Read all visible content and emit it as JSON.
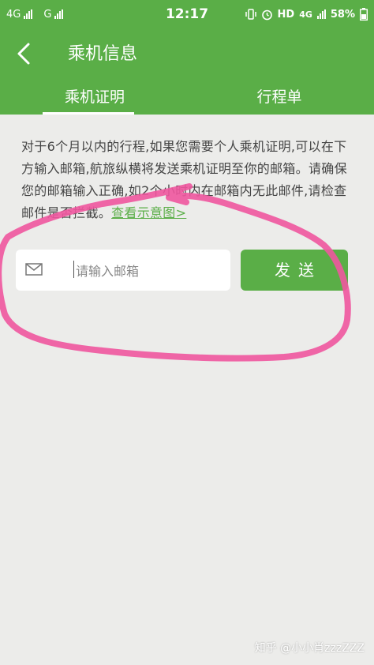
{
  "status": {
    "left_network_1": "4G",
    "left_network_2": "G",
    "time": "12:17",
    "right_network": "HD",
    "right_4g": "4G",
    "battery": "58%"
  },
  "header": {
    "title": "乘机信息"
  },
  "tabs": [
    {
      "label": "乘机证明",
      "active": true
    },
    {
      "label": "行程单",
      "active": false
    }
  ],
  "notice": {
    "text": "对于6个月以内的行程,如果您需要个人乘机证明,可以在下方输入邮箱,航旅纵横将发送乘机证明至你的邮箱。请确保您的邮箱输入正确,如2个小时内在邮箱内无此邮件,请检查邮件是否拦截。",
    "link": "查看示意图>"
  },
  "email": {
    "placeholder": "请输入邮箱",
    "value": ""
  },
  "send_button": {
    "label": "发送"
  },
  "watermark": "知乎 @小小肖zzzZZZ",
  "colors": {
    "primary_green": "#5aae47",
    "background": "#ececea",
    "annotation_pink": "#f0579e"
  },
  "icons": [
    "back-arrow-icon",
    "mail-icon",
    "vibrate-icon",
    "alarm-icon",
    "battery-icon"
  ]
}
